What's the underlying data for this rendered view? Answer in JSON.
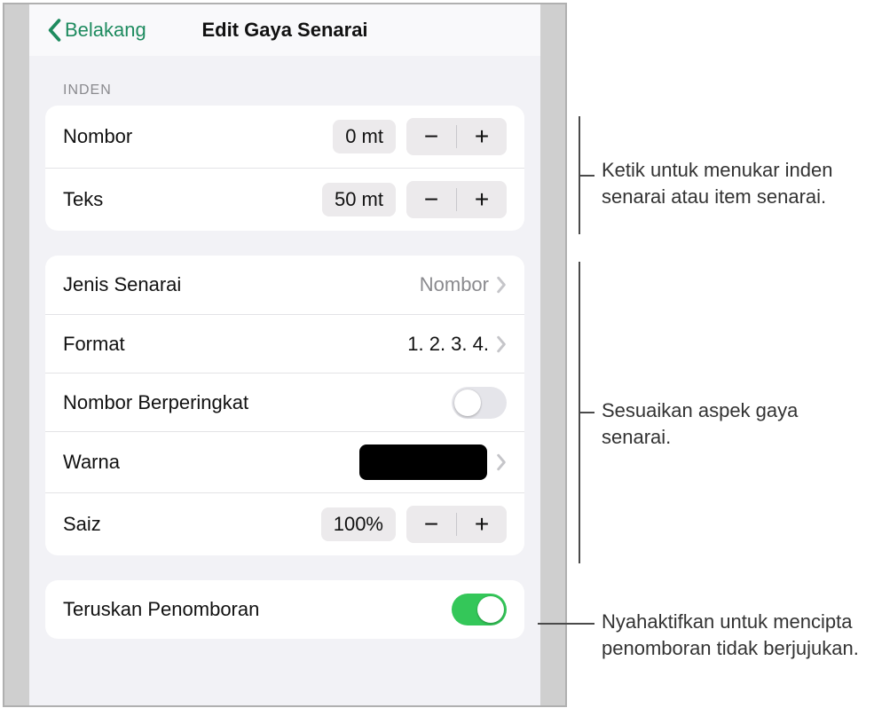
{
  "nav": {
    "back_label": "Belakang",
    "title": "Edit Gaya Senarai"
  },
  "indent": {
    "header": "INDEN",
    "number": {
      "label": "Nombor",
      "value": "0 mt"
    },
    "text": {
      "label": "Teks",
      "value": "50 mt"
    }
  },
  "style": {
    "list_type": {
      "label": "Jenis Senarai",
      "value": "Nombor"
    },
    "format": {
      "label": "Format",
      "value": "1. 2. 3. 4."
    },
    "ranked": {
      "label": "Nombor Berperingkat",
      "on": false
    },
    "color": {
      "label": "Warna",
      "swatch_hex": "#000000"
    },
    "size": {
      "label": "Saiz",
      "value": "100%"
    }
  },
  "continue": {
    "label": "Teruskan Penomboran",
    "on": true
  },
  "callouts": {
    "indent": "Ketik untuk menukar inden senarai atau item senarai.",
    "style": "Sesuaikan aspek gaya senarai.",
    "continue": "Nyahaktifkan untuk mencipta penomboran tidak berjujukan."
  }
}
